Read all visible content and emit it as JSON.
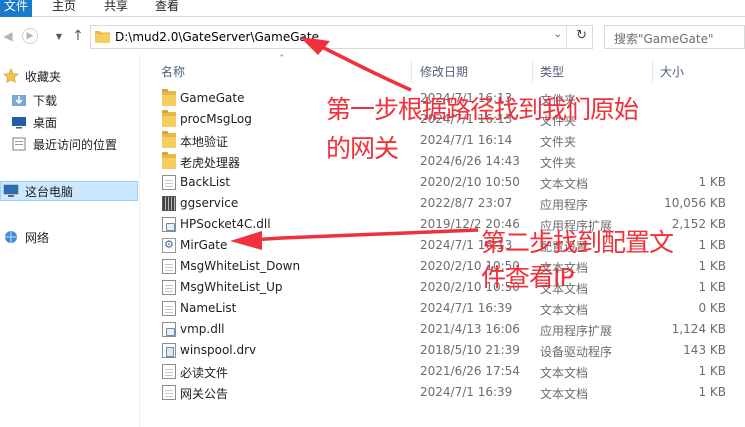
{
  "ribbon": {
    "tabs": [
      "文件",
      "主页",
      "共享",
      "查看"
    ]
  },
  "address": {
    "path": "D:\\mud2.0\\GateServer\\GameGate",
    "dropdown_icon": "chevron-down-icon",
    "refresh_icon": "refresh-icon"
  },
  "search": {
    "placeholder": "搜索\"GameGate\""
  },
  "navigation": {
    "quick_access": "收藏夹",
    "downloads": "下载",
    "desktop": "桌面",
    "recent": "最近访问的位置",
    "this_pc": "这台电脑",
    "network": "网络"
  },
  "columns": {
    "name": "名称",
    "date": "修改日期",
    "type": "类型",
    "size": "大小"
  },
  "files": [
    {
      "name": "GameGate",
      "date": "2024/7/1 16:13",
      "type": "文件夹",
      "size": "",
      "icon": "folder"
    },
    {
      "name": "procMsgLog",
      "date": "2024/7/1 16:13",
      "type": "文件夹",
      "size": "",
      "icon": "folder"
    },
    {
      "name": "本地验证",
      "date": "2024/7/1 16:14",
      "type": "文件夹",
      "size": "",
      "icon": "folder"
    },
    {
      "name": "老虎处理器",
      "date": "2024/6/26 14:43",
      "type": "文件夹",
      "size": "",
      "icon": "folder"
    },
    {
      "name": "BackList",
      "date": "2020/2/10 10:50",
      "type": "文本文档",
      "size": "1 KB",
      "icon": "doc"
    },
    {
      "name": "ggservice",
      "date": "2022/8/7 23:07",
      "type": "应用程序",
      "size": "10,056 KB",
      "icon": "exe"
    },
    {
      "name": "HPSocket4C.dll",
      "date": "2019/12/2 20:46",
      "type": "应用程序扩展",
      "size": "2,152 KB",
      "icon": "dll"
    },
    {
      "name": "MirGate",
      "date": "2024/7/1 16:13",
      "type": "配置设置",
      "size": "1 KB",
      "icon": "cfg"
    },
    {
      "name": "MsgWhiteList_Down",
      "date": "2020/2/10 10:50",
      "type": "文本文档",
      "size": "1 KB",
      "icon": "doc"
    },
    {
      "name": "MsgWhiteList_Up",
      "date": "2020/2/10 10:50",
      "type": "文本文档",
      "size": "1 KB",
      "icon": "doc"
    },
    {
      "name": "NameList",
      "date": "2024/7/1 16:39",
      "type": "文本文档",
      "size": "0 KB",
      "icon": "doc"
    },
    {
      "name": "vmp.dll",
      "date": "2021/4/13 16:06",
      "type": "应用程序扩展",
      "size": "1,124 KB",
      "icon": "dll"
    },
    {
      "name": "winspool.drv",
      "date": "2018/5/10 21:39",
      "type": "设备驱动程序",
      "size": "143 KB",
      "icon": "drv"
    },
    {
      "name": "必读文件",
      "date": "2021/6/26 17:54",
      "type": "文本文档",
      "size": "1 KB",
      "icon": "doc"
    },
    {
      "name": "网关公告",
      "date": "2024/7/1 16:39",
      "type": "文本文档",
      "size": "1 KB",
      "icon": "doc"
    }
  ],
  "annotations": {
    "step1_line1": "第一步根据路径找到我们原始",
    "step1_line2": "的网关",
    "step2_line1": "第二步找到配置文",
    "step2_line2": "件查看IP"
  },
  "colors": {
    "accent": "#1979ca",
    "annotation": "#f0303a",
    "folder": "#f6ce60",
    "selection": "#cce8ff"
  }
}
